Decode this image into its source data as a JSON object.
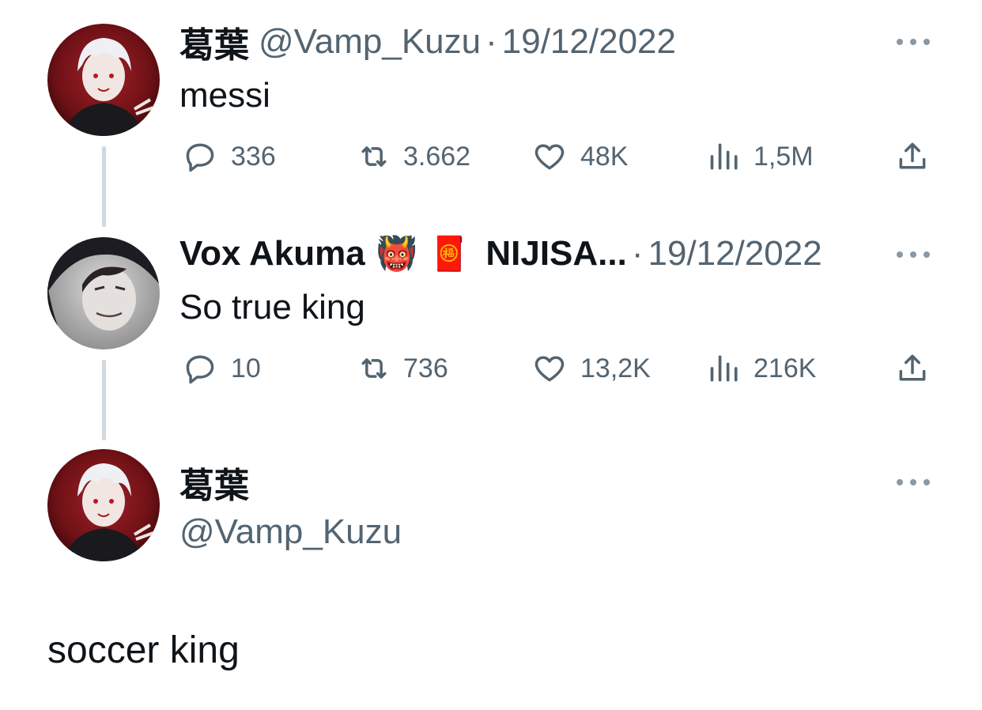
{
  "tweet1": {
    "display_name": "葛葉",
    "handle": "@Vamp_Kuzu",
    "separator": "·",
    "date": "19/12/2022",
    "text": "messi",
    "stats": {
      "replies": "336",
      "retweets": "3.662",
      "likes": "48K",
      "views": "1,5M"
    }
  },
  "tweet2": {
    "display_name": "Vox Akuma",
    "emoji_1": "👹",
    "emoji_2": "🧧",
    "name_suffix": "NIJISA...",
    "separator": "·",
    "date": "19/12/2022",
    "text": "So true king",
    "stats": {
      "replies": "10",
      "retweets": "736",
      "likes": "13,2K",
      "views": "216K"
    }
  },
  "tweet3": {
    "display_name": "葛葉",
    "handle": "@Vamp_Kuzu",
    "text": "soccer king"
  },
  "icons": {
    "reply": "reply-bubble-icon",
    "retweet": "retweet-icon",
    "like": "heart-icon",
    "views": "views-bar-icon",
    "share": "share-icon",
    "more": "more-dots-icon"
  },
  "colors": {
    "text": "#0f1419",
    "muted": "#536471",
    "thread_line": "#cfd9de",
    "avatar_red": "#7a1418"
  }
}
